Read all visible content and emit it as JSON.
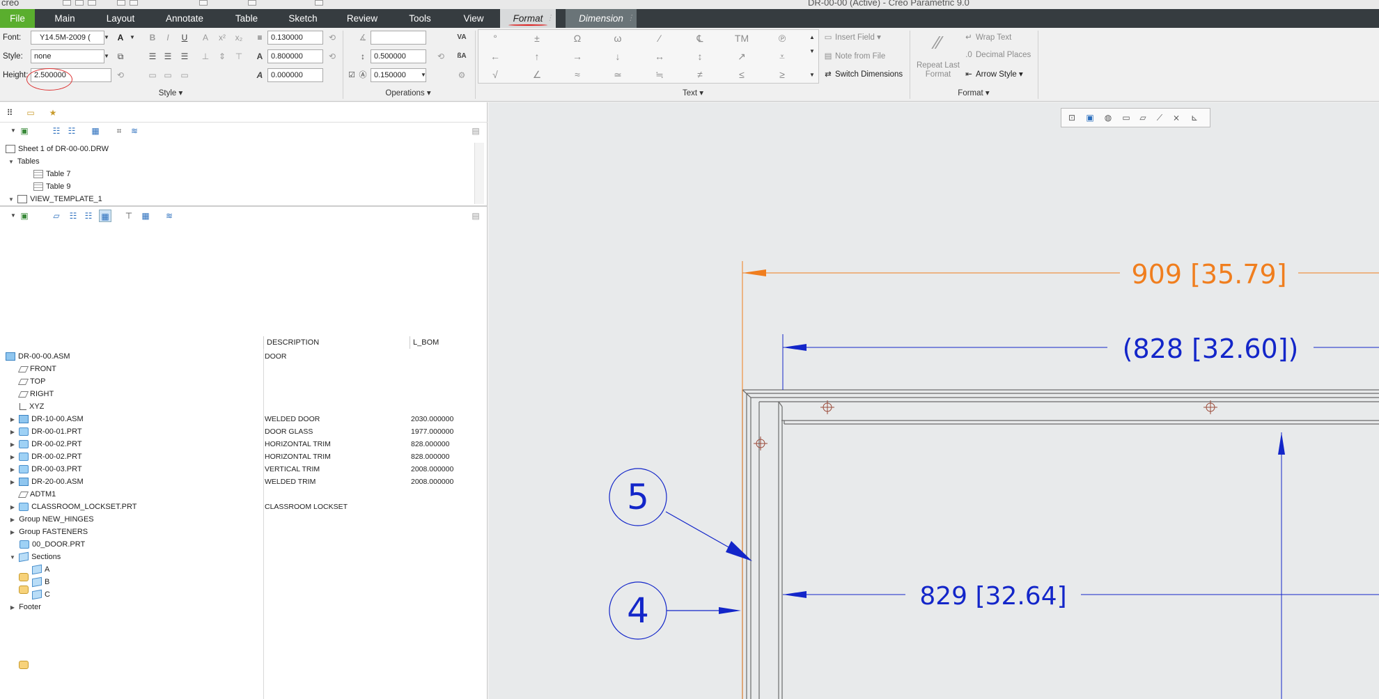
{
  "title_bar": {
    "app": "creo",
    "document": "DR-00-00 (Active) - Creo Parametric 9.0"
  },
  "tabs": [
    {
      "label": "File"
    },
    {
      "label": "Main"
    },
    {
      "label": "Layout"
    },
    {
      "label": "Annotate"
    },
    {
      "label": "Table"
    },
    {
      "label": "Sketch"
    },
    {
      "label": "Review"
    },
    {
      "label": "Tools"
    },
    {
      "label": "View"
    },
    {
      "label": "Format"
    },
    {
      "label": "Dimension"
    }
  ],
  "ribbon": {
    "font_label": "Font:",
    "font_value": "Y14.5M-2009 (",
    "style_label": "Style:",
    "style_value": "none",
    "height_label": "Height:",
    "height_value": "2.500000",
    "thickness_value": "0.130000",
    "width_factor_value": "0.800000",
    "slant_value": "0.000000",
    "ops_text_value": "",
    "line_spacing_value": "0.500000",
    "underline_offset_value": "0.150000",
    "group_style": "Style",
    "group_operations": "Operations",
    "group_text": "Text",
    "group_format": "Format",
    "symbols": [
      "°",
      "±",
      "Ω",
      "ω",
      "∕",
      "℄",
      "TM",
      "℗",
      "←",
      "↑",
      "→",
      "↓",
      "↔",
      "↕",
      "↗",
      "⩡",
      "√",
      "∠",
      "≈",
      "≃",
      "≒",
      "≠",
      "≤",
      "≥"
    ],
    "insert_field": "Insert Field",
    "note_from_file": "Note from File",
    "switch_dimensions": "Switch Dimensions",
    "repeat_last_format": "Repeat Last Format",
    "wrap_text": "Wrap Text",
    "decimal_places": "Decimal Places",
    "arrow_style": "Arrow Style"
  },
  "layer_tree": {
    "sheet": "Sheet 1 of DR-00-00.DRW",
    "tables_label": "Tables",
    "tables": [
      "Table 7",
      "Table 9"
    ],
    "view": "VIEW_TEMPLATE_1"
  },
  "model_tree": {
    "col_description": "DESCRIPTION",
    "col_lbom": "L_BOM",
    "items": [
      {
        "name": "DR-00-00.ASM",
        "desc": "DOOR",
        "lbom": ""
      },
      {
        "name": "FRONT",
        "desc": "",
        "lbom": ""
      },
      {
        "name": "TOP",
        "desc": "",
        "lbom": ""
      },
      {
        "name": "RIGHT",
        "desc": "",
        "lbom": ""
      },
      {
        "name": "XYZ",
        "desc": "",
        "lbom": ""
      },
      {
        "name": "DR-10-00.ASM",
        "desc": "WELDED DOOR",
        "lbom": "2030.000000"
      },
      {
        "name": "DR-00-01.PRT",
        "desc": "DOOR GLASS",
        "lbom": "1977.000000"
      },
      {
        "name": "DR-00-02.PRT",
        "desc": "HORIZONTAL TRIM",
        "lbom": "828.000000"
      },
      {
        "name": "DR-00-02.PRT",
        "desc": "HORIZONTAL TRIM",
        "lbom": "828.000000"
      },
      {
        "name": "DR-00-03.PRT",
        "desc": "VERTICAL TRIM",
        "lbom": "2008.000000"
      },
      {
        "name": "DR-20-00.ASM",
        "desc": "WELDED TRIM",
        "lbom": "2008.000000"
      },
      {
        "name": "ADTM1",
        "desc": "",
        "lbom": ""
      },
      {
        "name": "CLASSROOM_LOCKSET.PRT",
        "desc": "CLASSROOM LOCKSET",
        "lbom": ""
      },
      {
        "name": "Group NEW_HINGES",
        "desc": "",
        "lbom": ""
      },
      {
        "name": "Group FASTENERS",
        "desc": "",
        "lbom": ""
      },
      {
        "name": "00_DOOR.PRT",
        "desc": "",
        "lbom": ""
      },
      {
        "name": "Sections",
        "desc": "",
        "lbom": ""
      },
      {
        "name": "A",
        "desc": "",
        "lbom": ""
      },
      {
        "name": "B",
        "desc": "",
        "lbom": ""
      },
      {
        "name": "C",
        "desc": "",
        "lbom": ""
      },
      {
        "name": "Footer",
        "desc": "",
        "lbom": ""
      }
    ]
  },
  "drawing": {
    "dim_overall": "909 [35.79]",
    "dim_reference": "(828 [32.60])",
    "dim_inner": "829 [32.64]",
    "balloon_upper": "5",
    "balloon_lower": "4",
    "colors": {
      "selected_dim": "#f07e1e",
      "dim": "#1326c9",
      "geometry": "#6b6b6b",
      "background": "#e8eaeb"
    }
  }
}
